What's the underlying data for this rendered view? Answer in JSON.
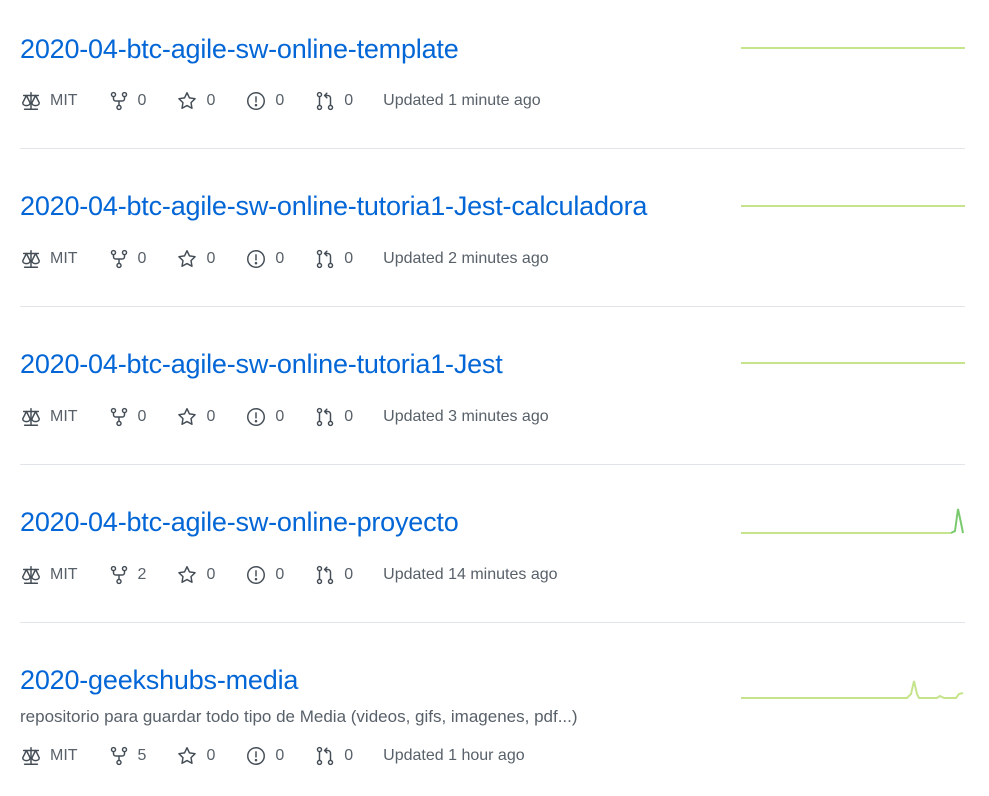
{
  "repos": [
    {
      "name": "2020-04-btc-agile-sw-online-template",
      "description": "",
      "license": "MIT",
      "forks": "0",
      "stars": "0",
      "issues": "0",
      "pulls": "0",
      "updated": "Updated 1 minute ago",
      "activity": "flat"
    },
    {
      "name": "2020-04-btc-agile-sw-online-tutoria1-Jest-calculadora",
      "description": "",
      "license": "MIT",
      "forks": "0",
      "stars": "0",
      "issues": "0",
      "pulls": "0",
      "updated": "Updated 2 minutes ago",
      "activity": "flat"
    },
    {
      "name": "2020-04-btc-agile-sw-online-tutoria1-Jest",
      "description": "",
      "license": "MIT",
      "forks": "0",
      "stars": "0",
      "issues": "0",
      "pulls": "0",
      "updated": "Updated 3 minutes ago",
      "activity": "flat"
    },
    {
      "name": "2020-04-btc-agile-sw-online-proyecto",
      "description": "",
      "license": "MIT",
      "forks": "2",
      "stars": "0",
      "issues": "0",
      "pulls": "0",
      "updated": "Updated 14 minutes ago",
      "activity": "spike at end"
    },
    {
      "name": "2020-geekshubs-media",
      "description": "repositorio para guardar todo tipo de Media (videos, gifs, imagenes, pdf...)",
      "license": "MIT",
      "forks": "5",
      "stars": "0",
      "issues": "0",
      "pulls": "0",
      "updated": "Updated 1 hour ago",
      "activity": "small spikes near end"
    }
  ],
  "colors": {
    "link": "#0366d6",
    "muted": "#586069",
    "divider": "#e1e4e8",
    "spark_light": "#c6e48b",
    "spark_dark": "#7bc96f"
  },
  "icons": [
    "law-icon",
    "repo-forked-icon",
    "star-icon",
    "issue-opened-icon",
    "git-pull-request-icon"
  ]
}
